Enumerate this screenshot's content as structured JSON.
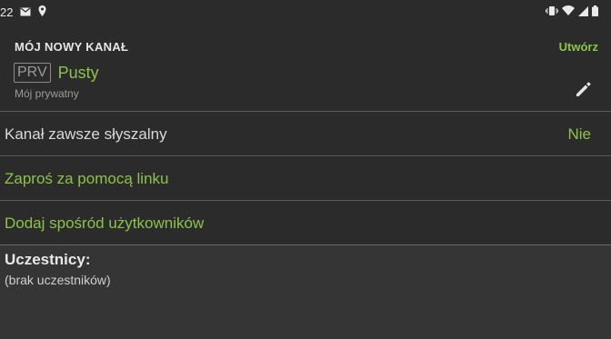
{
  "status_bar": {
    "time": "22",
    "left_icons": [
      "mail-icon",
      "location-icon"
    ],
    "right_icons": [
      "vibrate-icon",
      "wifi-icon",
      "signal-icon",
      "battery-icon"
    ]
  },
  "header": {
    "title": "MÓJ NOWY KANAŁ",
    "create_label": "Utwórz",
    "badge": "PRV",
    "state": "Pusty",
    "subtitle": "Mój prywatny",
    "edit_icon": "pencil-icon"
  },
  "rows": {
    "always_audible": {
      "label": "Kanał zawsze słyszalny",
      "value": "Nie"
    },
    "invite_link": {
      "label": "Zaproś za pomocą linku"
    },
    "add_users": {
      "label": "Dodaj spośród użytkowników"
    }
  },
  "participants": {
    "title": "Uczestnicy:",
    "empty_text": "(brak uczestników)"
  },
  "colors": {
    "accent": "#8bc34a",
    "background": "#2b2b2b"
  }
}
